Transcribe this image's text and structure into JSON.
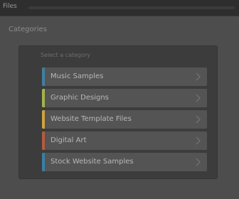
{
  "header": {
    "title": "Files",
    "links": ""
  },
  "page": {
    "heading": "Categories"
  },
  "panel": {
    "title": "Select a category"
  },
  "items": [
    {
      "label": "Music Samples",
      "accent": "#3f7fa0"
    },
    {
      "label": "Graphic Designs",
      "accent": "#a4b24a"
    },
    {
      "label": "Website Template Files",
      "accent": "#d0a23e"
    },
    {
      "label": "Digital Art",
      "accent": "#b65a3f"
    },
    {
      "label": "Stock Website Samples",
      "accent": "#3a7fa6"
    }
  ]
}
